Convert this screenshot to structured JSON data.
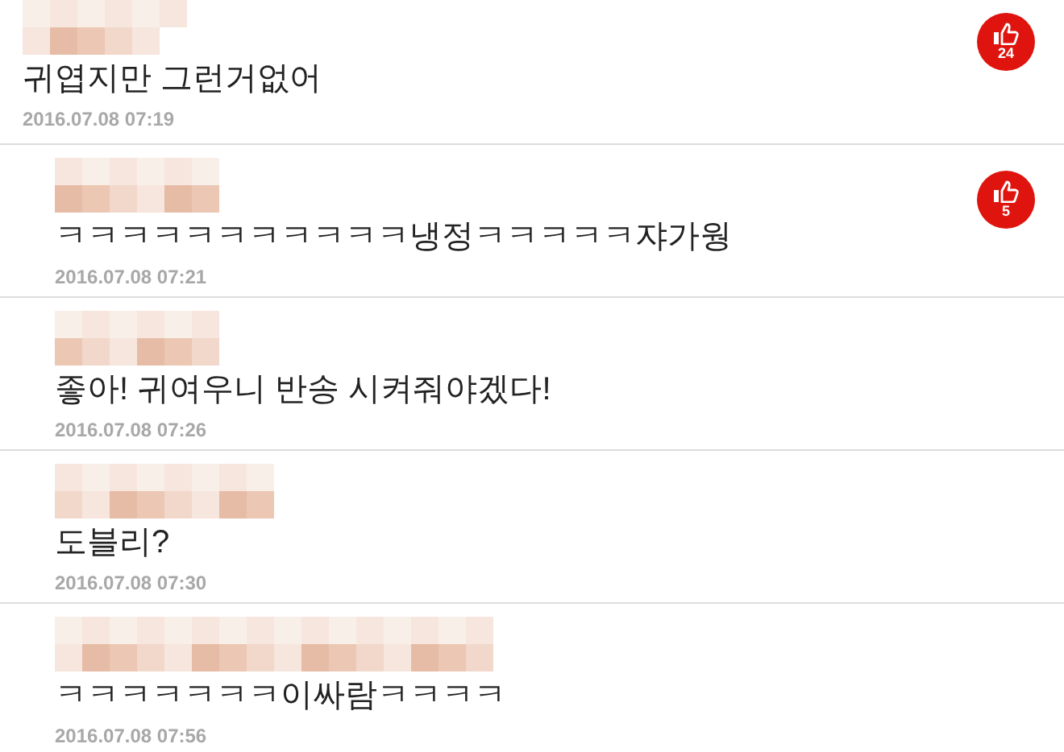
{
  "comments": [
    {
      "text": "귀엽지만 그런거없어",
      "date": "2016.07.08 07:19",
      "likes": "24",
      "replies": [
        {
          "text": "ㅋㅋㅋㅋㅋㅋㅋㅋㅋㅋㅋ냉정ㅋㅋㅋㅋㅋ쟈가웡",
          "date": "2016.07.08 07:21",
          "likes": "5"
        },
        {
          "text": "좋아! 귀여우니 반송 시켜줘야겠다!",
          "date": "2016.07.08 07:26"
        },
        {
          "text": "도블리?",
          "date": "2016.07.08 07:30"
        },
        {
          "text": "ㅋㅋㅋㅋㅋㅋㅋ이싸람ㅋㅋㅋㅋ",
          "date": "2016.07.08 07:56"
        }
      ]
    }
  ]
}
